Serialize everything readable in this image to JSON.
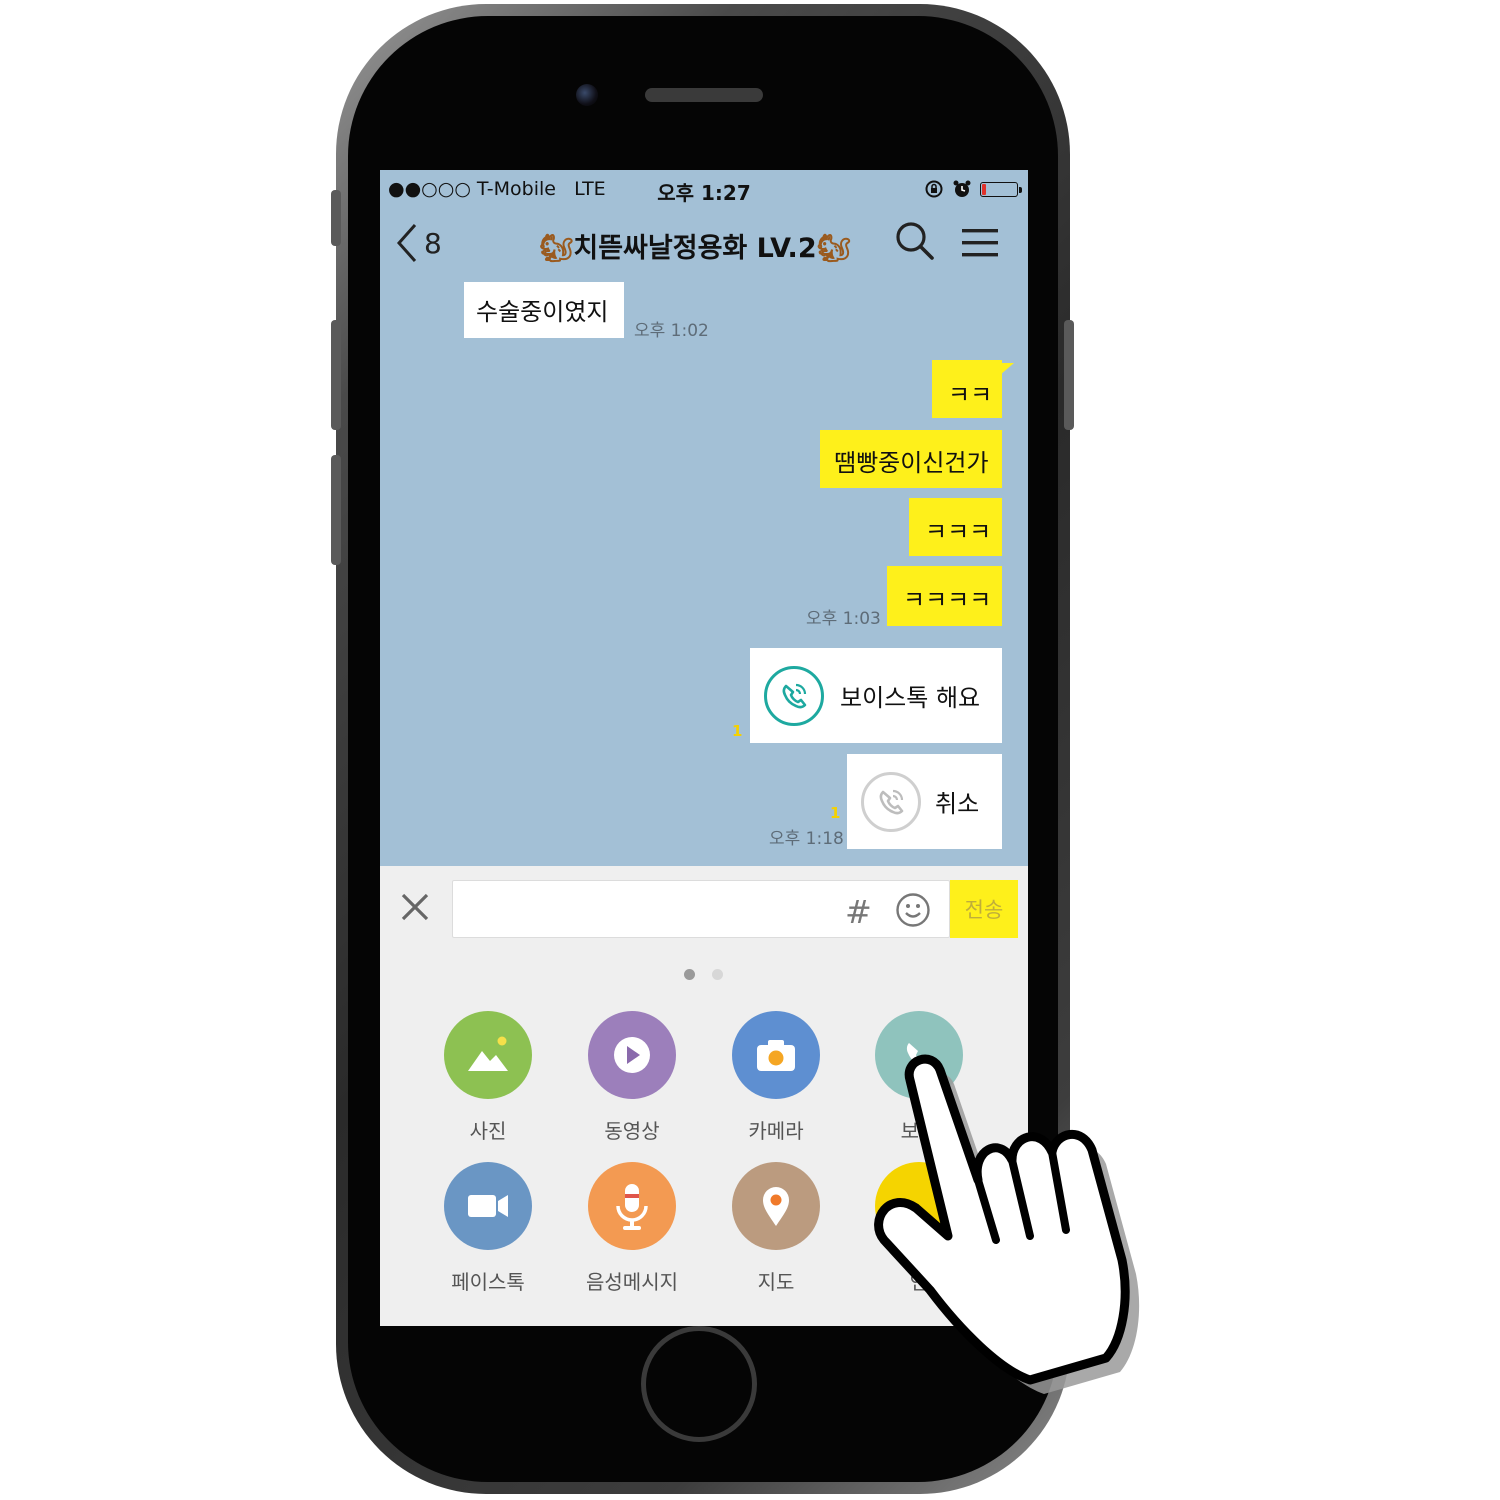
{
  "status_bar": {
    "carrier": "●●○○○ T-Mobile",
    "network": "LTE",
    "time": "오후 1:27",
    "battery_level": 0.12,
    "icons": [
      "rotation-lock-icon",
      "alarm-icon",
      "battery-icon"
    ]
  },
  "header": {
    "back_count": "8",
    "title_emoji": "🐿",
    "title": "치뜯싸날정용화 LV.2"
  },
  "messages": [
    {
      "side": "received",
      "text": "수술중이였지",
      "time": "오후 1:02"
    },
    {
      "side": "sent",
      "text": "ㅋㅋ"
    },
    {
      "side": "sent",
      "text": "땜빵중이신건가"
    },
    {
      "side": "sent",
      "text": "ㅋㅋㅋ"
    },
    {
      "side": "sent",
      "text": "ㅋㅋㅋㅋ",
      "time": "오후 1:03"
    },
    {
      "side": "sent",
      "type": "voicetalk",
      "text": "보이스톡 해요",
      "unread": "1"
    },
    {
      "side": "sent",
      "type": "voicetalk-cancel",
      "text": "취소",
      "unread": "1",
      "time": "오후 1:18"
    }
  ],
  "input": {
    "placeholder": "",
    "hash": "#",
    "send_label": "전송"
  },
  "panel": {
    "page_index": 0,
    "page_count": 2,
    "items": [
      {
        "label": "사진",
        "icon": "photo-icon",
        "color": "#8dc152"
      },
      {
        "label": "동영상",
        "icon": "video-play-icon",
        "color": "#9c7fbb"
      },
      {
        "label": "카메라",
        "icon": "camera-icon",
        "color": "#5e8fd1"
      },
      {
        "label": "보이",
        "icon": "voicetalk-phone-icon",
        "color": "#8fc3bd"
      },
      {
        "label": "페이스톡",
        "icon": "facetalk-video-icon",
        "color": "#6a96c4"
      },
      {
        "label": "음성메시지",
        "icon": "microphone-icon",
        "color": "#f39a52"
      },
      {
        "label": "지도",
        "icon": "map-pin-icon",
        "color": "#bb9b7f"
      },
      {
        "label": "연",
        "icon": "contact-icon",
        "color": "#f5d400"
      }
    ]
  },
  "colors": {
    "chat_bg": "#a3c0d6",
    "sent_bubble": "#fef01b",
    "received_bubble": "#ffffff",
    "voicetalk_teal": "#1ea9a0"
  }
}
